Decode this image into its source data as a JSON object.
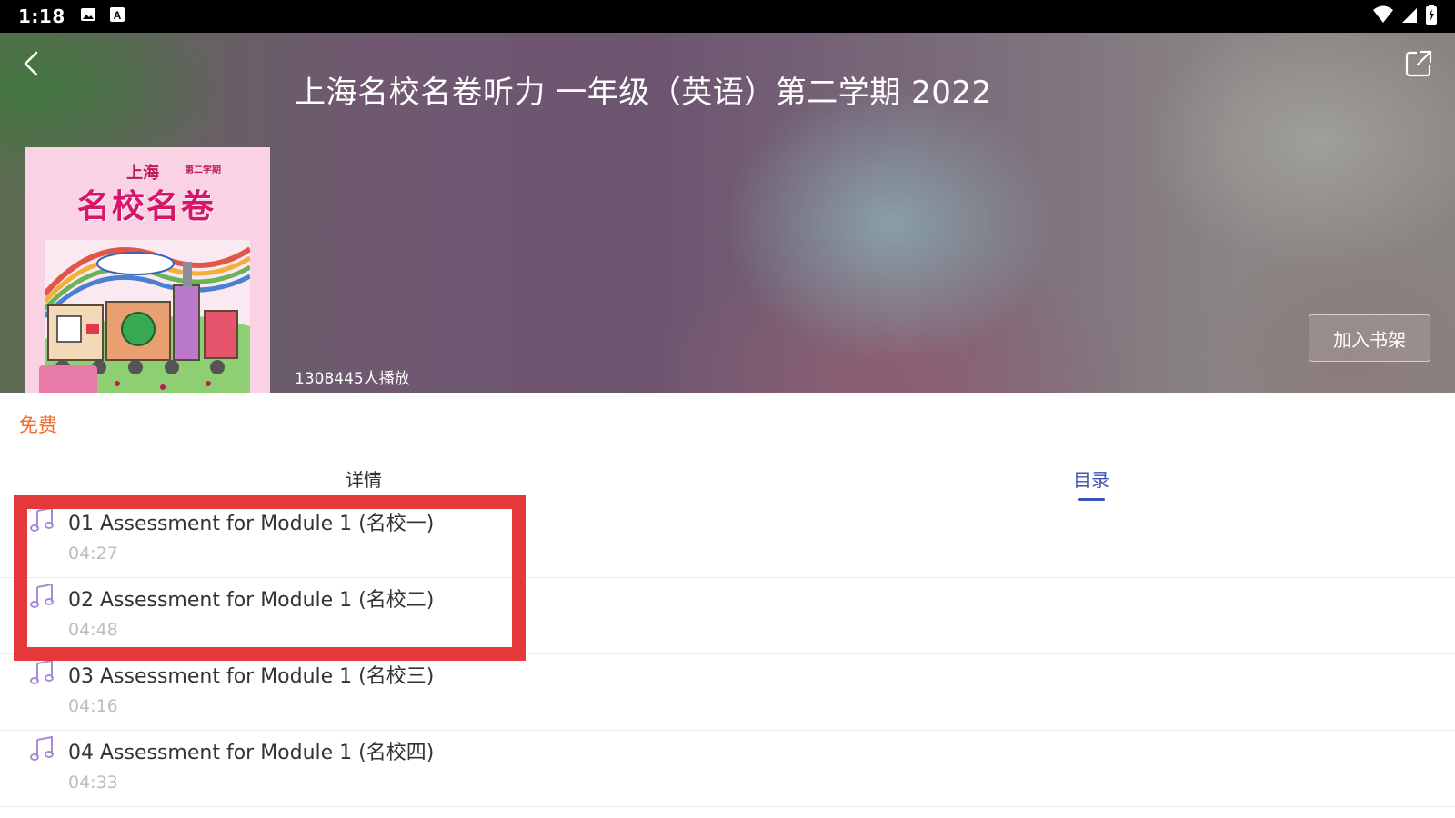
{
  "status_bar": {
    "time": "1:18",
    "notification_icons": [
      "image-icon",
      "a-badge-icon"
    ],
    "system_icons": [
      "wifi-icon",
      "signal-icon",
      "battery-icon"
    ]
  },
  "header": {
    "title": "上海名校名卷听力 一年级（英语）第二学期 2022",
    "back_icon": "chevron-left-icon",
    "share_icon": "share-icon",
    "play_count": "1308445人播放",
    "shelf_button": "加入书架"
  },
  "cover": {
    "series": "上海",
    "term": "第二学期",
    "main_title": "名校名卷"
  },
  "price_label": "免费",
  "tabs": [
    {
      "label": "详情",
      "active": false
    },
    {
      "label": "目录",
      "active": true
    }
  ],
  "tracks": [
    {
      "title": "01 Assessment for Module 1 (名校一)",
      "duration": "04:27"
    },
    {
      "title": "02 Assessment for Module 1 (名校二)",
      "duration": "04:48"
    },
    {
      "title": "03 Assessment for Module 1 (名校三)",
      "duration": "04:16"
    },
    {
      "title": "04 Assessment for Module 1 (名校四)",
      "duration": "04:33"
    }
  ],
  "colors": {
    "accent": "#3f51b5",
    "price": "#f06b2b",
    "music_icon": "#a78bd6",
    "highlight": "#e5383b"
  }
}
